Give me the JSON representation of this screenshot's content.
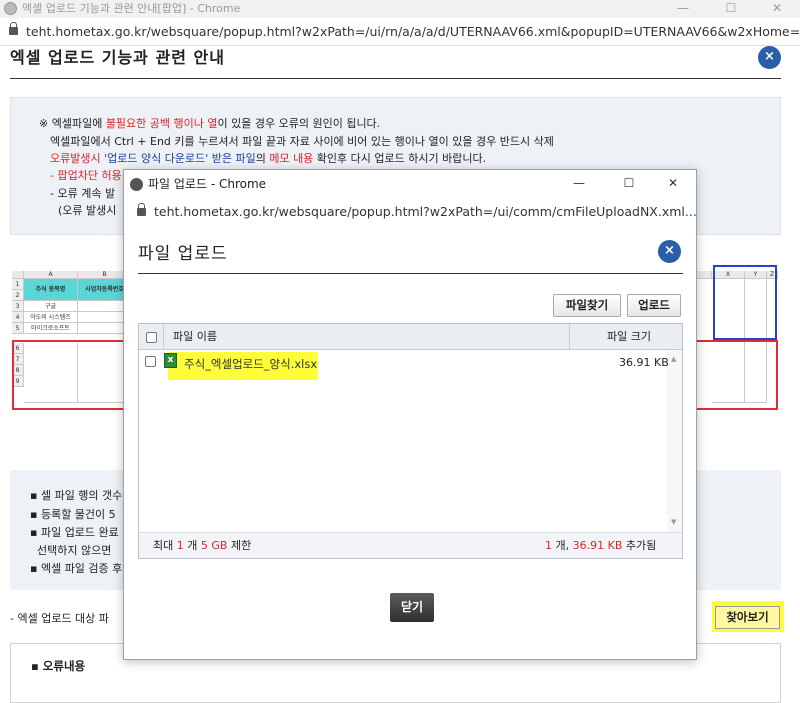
{
  "bg_window": {
    "title": "엑셀 업로드 기능과 관련 안내[팝업] - Chrome",
    "url": "teht.hometax.go.kr/websquare/popup.html?w2xPath=/ui/rn/a/a/a/d/UTERNAAV66.xml&popupID=UTERNAAV66&w2xHome=/ui/",
    "page_title": "엑셀 업로드 기능과 관련 안내",
    "close_label": "×",
    "minimize_label": "—",
    "maximize_label": "☐",
    "window_close_label": "✕"
  },
  "notice": {
    "line1_a": "※ 엑셀파일에 ",
    "line1_b": "불필요한 공백 행이나 열",
    "line1_c": "이 있을 경우 오류의 원인이 됩니다.",
    "line2": "엑셀파일에서 Ctrl + End 키를 누르셔서 파일 끝과 자료 사이에 비어 있는 행이나 열이 있을 경우 반드시 삭제",
    "line3_a": "오류발생시 ",
    "line3_b": "'업로드 양식 다운로드' 받은 파일",
    "line3_c": "의 ",
    "line3_d": "메모 내용",
    "line3_e": " 확인후 다시 업로드 하시기 바랍니다.",
    "line4": "- 팝업차단 허용",
    "line5": "- 오류 계속 발",
    "line6": "(오류 발생시"
  },
  "sheet": {
    "col_letters": [
      "A",
      "B"
    ],
    "header_cells": [
      "주식 종목명",
      "사업자등록번호"
    ],
    "rows": [
      "구글",
      "아도비 시스템즈",
      "마이크로소프트"
    ],
    "row_numbers": [
      "1",
      "2",
      "3",
      "4",
      "5",
      "6",
      "7",
      "8",
      "9"
    ],
    "right_col_letters": [
      "X",
      "Y",
      "Z"
    ]
  },
  "bottom_notes": [
    "▪ 셀 파일 행의 갯수",
    "▪ 등록할 물건이 5",
    "▪ 파일 업로드 완료",
    "  선택하지 않으면",
    "▪ 엑셀 파일 검증 후"
  ],
  "upload_target_label": "- 엑셀 업로드 대상 파",
  "browse_button": "찾아보기",
  "error_section_title": "▪ 오류내용",
  "popup": {
    "window_title": "파일 업로드 - Chrome",
    "url": "teht.hometax.go.kr/websquare/popup.html?w2xPath=/ui/comm/cmFileUploadNX.xml...",
    "heading": "파일 업로드",
    "close_label": "×",
    "minimize_label": "—",
    "maximize_label": "☐",
    "window_close_label": "✕",
    "find_file_button": "파일찾기",
    "upload_button": "업로드",
    "col_filename": "파일 이름",
    "col_filesize": "파일 크기",
    "files": [
      {
        "name": "주식_엑셀업로드_양식.xlsx",
        "size": "36.91 KB"
      }
    ],
    "footer_left_a": "최대 ",
    "footer_left_b": "1",
    "footer_left_c": " 개 ",
    "footer_left_d": "5 GB",
    "footer_left_e": " 제한",
    "footer_right_a": "1",
    "footer_right_b": " 개, ",
    "footer_right_c": "36.91 KB",
    "footer_right_d": " 추가됨",
    "close_button": "닫기"
  },
  "colors": {
    "accent_blue": "#2b5ea8",
    "highlight_yellow": "#fdfd3a",
    "warn_red": "#d7262d"
  }
}
